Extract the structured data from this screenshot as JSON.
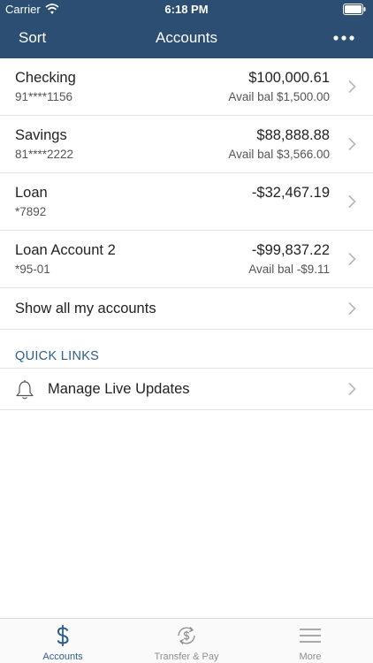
{
  "status_bar": {
    "carrier": "Carrier",
    "time": "6:18 PM"
  },
  "nav": {
    "left_action": "Sort",
    "title": "Accounts",
    "right_icon": "more-dots-icon"
  },
  "accounts": [
    {
      "name": "Checking",
      "number": "91****1156",
      "balance": "$100,000.61",
      "available": "Avail bal $1,500.00"
    },
    {
      "name": "Savings",
      "number": "81****2222",
      "balance": "$88,888.88",
      "available": "Avail bal $3,566.00"
    },
    {
      "name": "Loan",
      "number": "*7892",
      "balance": "-$32,467.19",
      "available": ""
    },
    {
      "name": "Loan Account 2",
      "number": "*95-01",
      "balance": "-$99,837.22",
      "available": "Avail bal -$9.11"
    }
  ],
  "show_all_label": "Show all my accounts",
  "quick_links": {
    "title": "QUICK LINKS",
    "items": [
      {
        "label": "Manage Live Updates",
        "icon": "bell-icon"
      }
    ]
  },
  "tabbar": {
    "tabs": [
      {
        "label": "Accounts",
        "icon": "dollar-icon",
        "active": true
      },
      {
        "label": "Transfer & Pay",
        "icon": "transfer-icon",
        "active": false
      },
      {
        "label": "More",
        "icon": "hamburger-icon",
        "active": false
      }
    ]
  },
  "colors": {
    "header": "#2b4e72",
    "accent": "#2b5e8a",
    "divider": "#e3e3e3"
  }
}
